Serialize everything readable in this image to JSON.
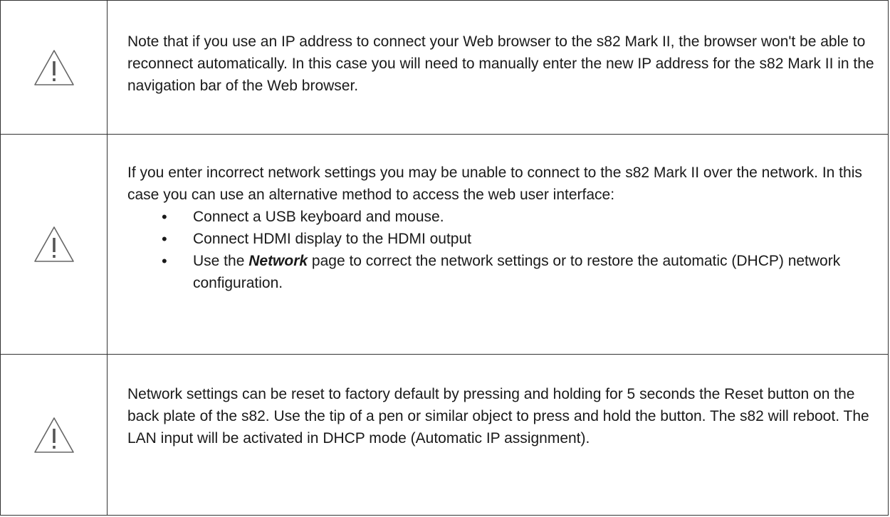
{
  "notes": [
    {
      "icon": "warning-triangle-icon",
      "text": "Note that if you use an IP address to connect your Web browser to the s82 Mark II, the browser won't be able to reconnect automatically. In this case you will need to manually enter the new IP address for the s82 Mark II in the navigation bar of the Web browser."
    },
    {
      "icon": "warning-triangle-icon",
      "intro": "If you enter incorrect network settings you may be unable to connect to the s82 Mark II over the network.  In this case you can use an alternative method to access the web user interface:",
      "bullets": [
        "Connect a USB keyboard and mouse.",
        "Connect HDMI display to the HDMI output"
      ],
      "bullet3": {
        "before": "Use the ",
        "emphasis": "Network",
        "after": " page to correct the network settings or to restore the automatic (DHCP) network configuration."
      }
    },
    {
      "icon": "warning-triangle-icon",
      "text": "Network settings can be reset to factory default by pressing and holding for 5 seconds the Reset button on the back plate of the s82. Use the tip of a pen or similar object to press and hold the button. The s82 will reboot. The LAN input will be activated in DHCP mode (Automatic IP assignment)."
    }
  ],
  "colors": {
    "border": "#333333",
    "text": "#1a1a1a",
    "icon": "#666666"
  }
}
